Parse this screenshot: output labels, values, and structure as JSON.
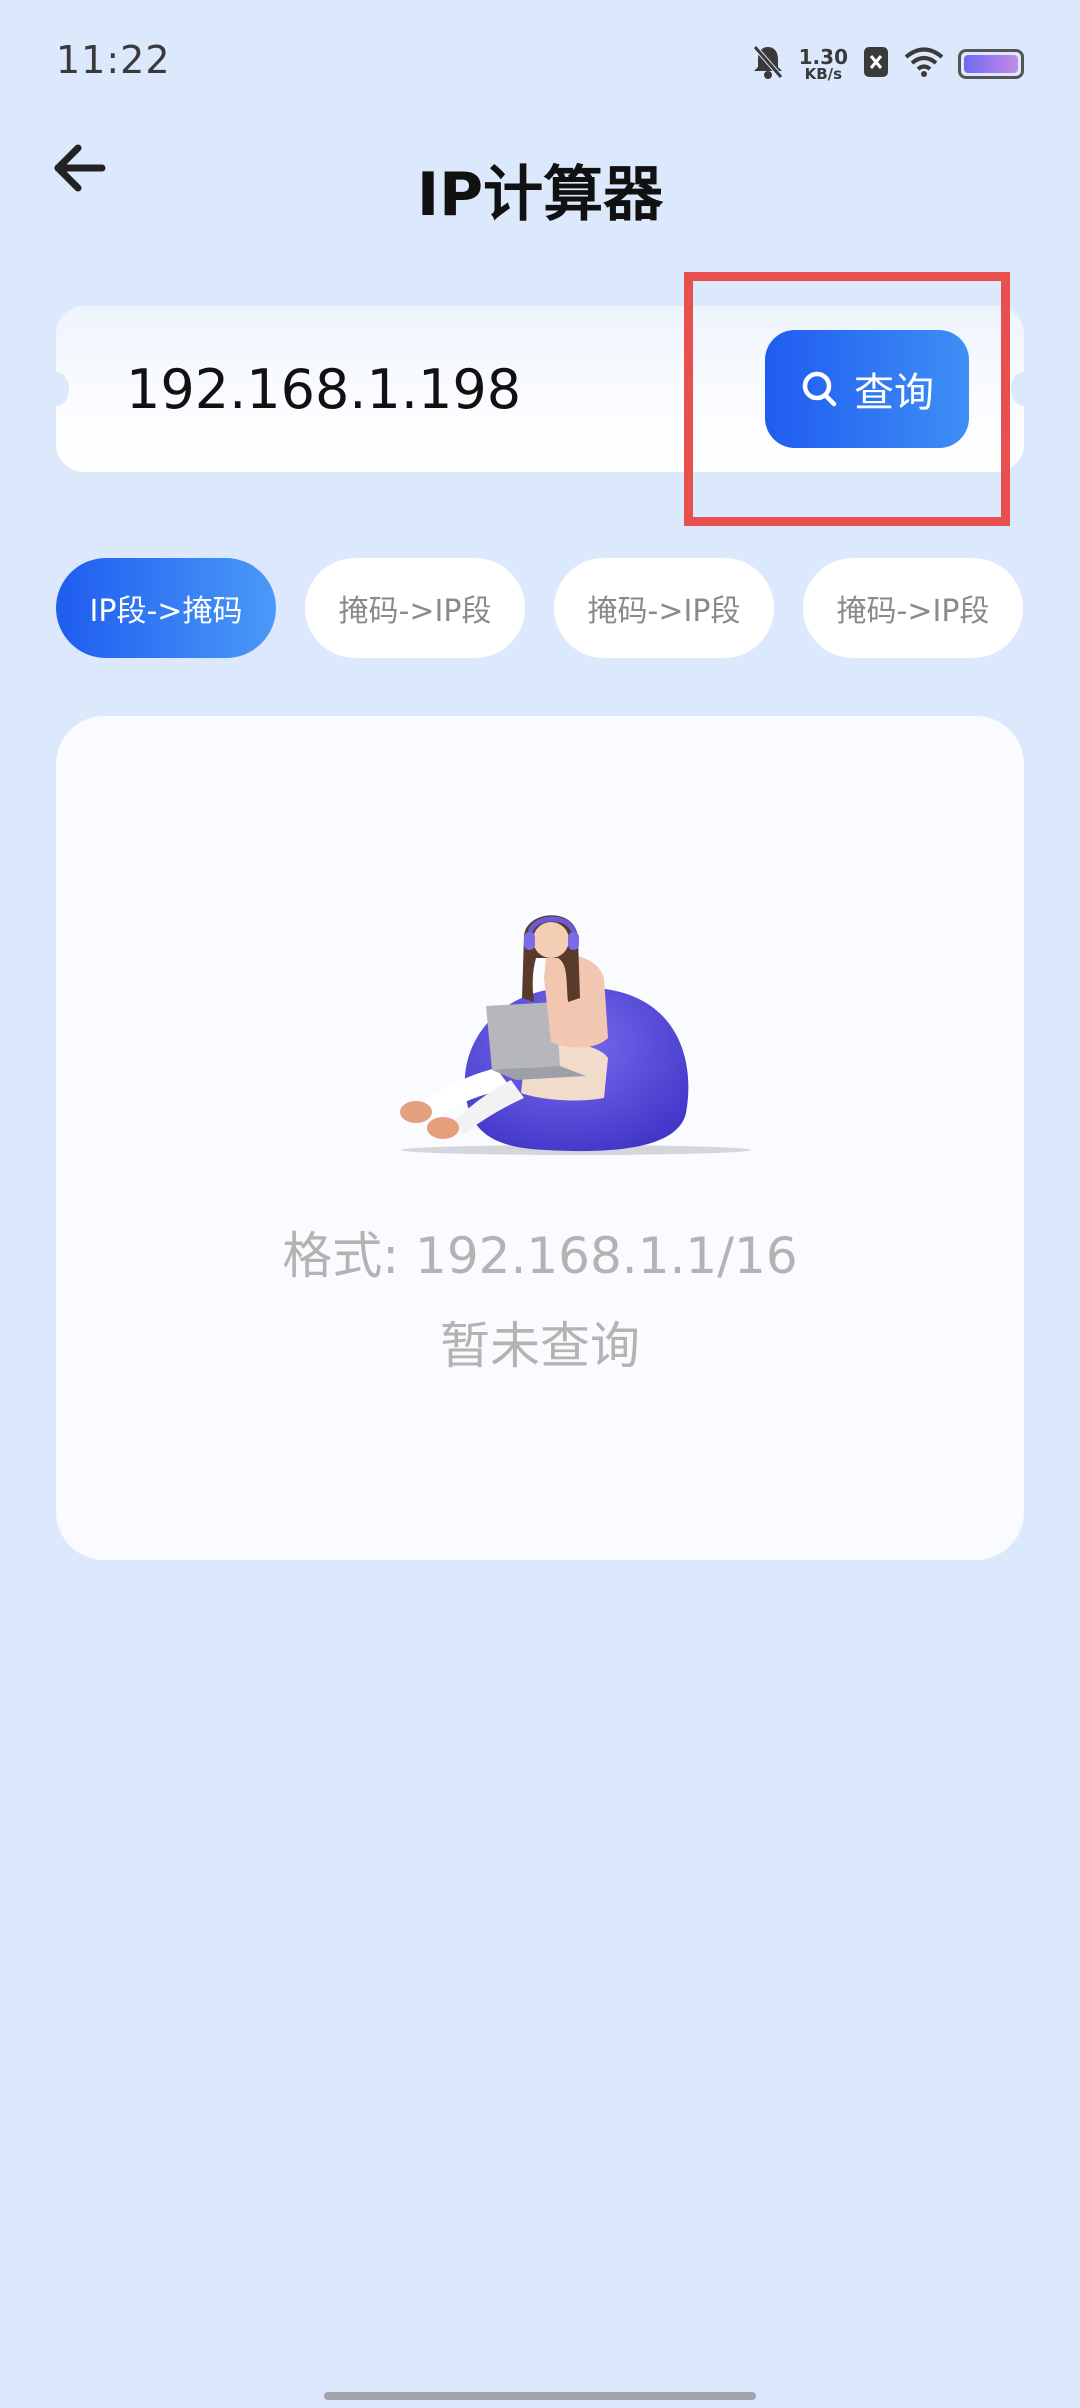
{
  "status_bar": {
    "time": "11:22",
    "net_speed_value": "1.30",
    "net_speed_unit": "KB/s",
    "icons": [
      "mute-bell-icon",
      "notification-x-icon",
      "wifi-icon",
      "battery-icon"
    ]
  },
  "header": {
    "back_icon": "arrow-left-icon",
    "title": "IP计算器"
  },
  "search": {
    "value": "192.168.1.198",
    "button_icon": "search-icon",
    "button_label": "查询",
    "highlight_color": "#e84f4f"
  },
  "tabs": [
    {
      "label": "IP段->掩码",
      "active": true
    },
    {
      "label": "掩码->IP段",
      "active": false
    },
    {
      "label": "掩码->IP段",
      "active": false
    },
    {
      "label": "掩码->IP段",
      "active": false
    }
  ],
  "result": {
    "illustration": "girl-with-laptop-on-beanbag-illustration",
    "format_hint": "格式: 192.168.1.1/16",
    "empty_text": "暂未查询"
  },
  "colors": {
    "background": "#dce8fb",
    "accent_start": "#1f5cf0",
    "accent_end": "#4a9af7",
    "muted_text": "#b3b3b3"
  }
}
